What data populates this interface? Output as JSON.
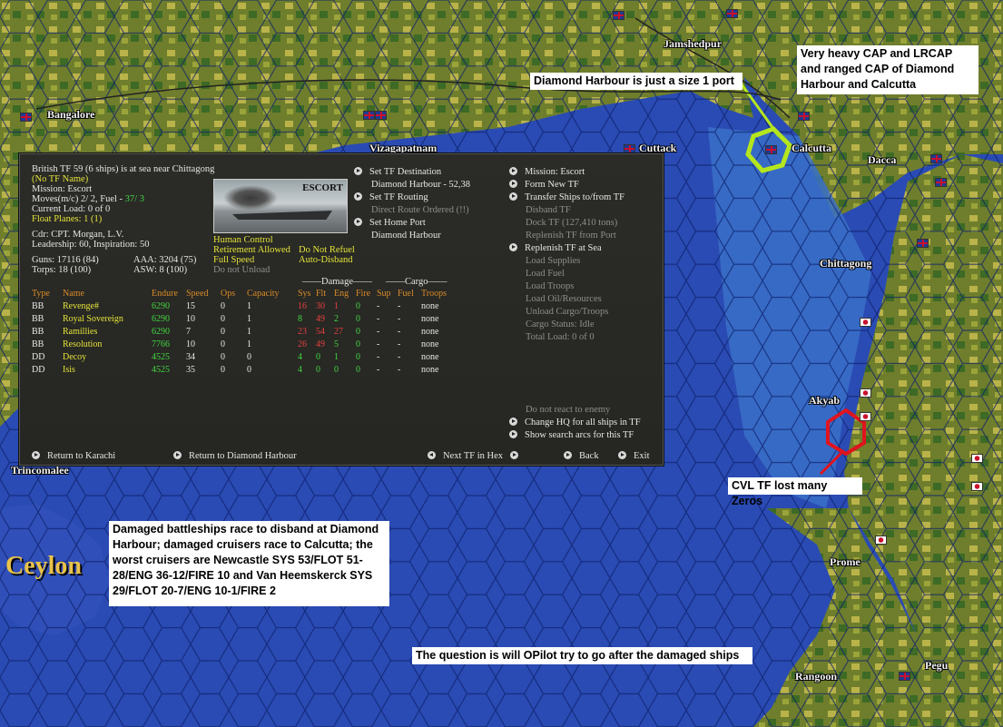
{
  "map_labels": {
    "bangalore": "Bangalore",
    "vizagapatnam": "Vizagapatnam",
    "cuttack": "Cuttack",
    "calcutta": "Calcutta",
    "jamshedpur": "Jamshedpur",
    "dacca": "Dacca",
    "chittagong": "Chittagong",
    "akyab": "Akyab",
    "trincomalee": "Trincomalee",
    "ceylon": "Ceylon",
    "prome": "Prome",
    "rangoon": "Rangoon",
    "pegu": "Pegu"
  },
  "annotations": {
    "cap": "Very heavy CAP and LRCAP and ranged CAP of Diamond Harbour and Calcutta",
    "diamond": "Diamond Harbour is just a size 1 port",
    "cvl": "CVL TF lost many Zeros",
    "damaged": "Damaged battleships race to disband at Diamond Harbour; damaged cruisers race to Calcutta; the worst cruisers are Newcastle SYS 53/FLOT 51-28/ENG 36-12/FIRE 10 and Van Heemskerck SYS 29/FLOT 20-7/ENG 10-1/FIRE 2",
    "question": "The question is will OPilot try to go after the damaged ships"
  },
  "tf": {
    "header": "British TF 59 (6 ships) is at sea near Chittagong",
    "name": "(No TF Name)",
    "mission": "Mission: Escort",
    "moves_a": "Moves(m/c) 2/ 2, Fuel - ",
    "moves_fuel": "37/ 3",
    "current_load": "Current Load: 0 of 0",
    "float_planes": "Float Planes: 1 (1)",
    "cdr": "Cdr: CPT. Morgan, L.V.",
    "leadership": "Leadership: 60, Inspiration: 50",
    "guns": "Guns: 17116 (84)",
    "aaa": "AAA: 3204 (75)",
    "torps": "Torps: 18 (100)",
    "asw": "ASW: 8 (100)",
    "photo_label": "ESCORT",
    "human_control": "Human Control",
    "retirement": "Retirement Allowed",
    "do_not_refuel": "Do Not Refuel",
    "full_speed": "Full Speed",
    "auto_disband": "Auto-Disband",
    "do_not_unload": "Do not Unload"
  },
  "middle_menu": {
    "set_destination": "Set TF Destination",
    "destination_value": "Diamond Harbour - 52,38",
    "set_routing": "Set TF Routing",
    "direct_route": "Direct Route Ordered (!!)",
    "set_home_port": "Set Home Port",
    "home_port_value": "Diamond Harbour"
  },
  "right_menu": {
    "mission": "Mission: Escort",
    "form_new": "Form New TF",
    "transfer": "Transfer Ships to/from TF",
    "disband": "Disband TF",
    "dock": "Dock TF (127,410 tons)",
    "replenish_port": "Replenish TF from Port",
    "replenish_sea": "Replenish TF at Sea",
    "load_supplies": "Load Supplies",
    "load_fuel": "Load Fuel",
    "load_troops": "Load Troops",
    "load_oil": "Load Oil/Resources",
    "unload": "Unload Cargo/Troops",
    "cargo_status": "Cargo Status: Idle",
    "total_load": "Total Load: 0 of 0",
    "do_not_react": "Do not react to enemy",
    "change_hq": "Change HQ for all ships in TF",
    "show_arcs": "Show search arcs for this TF"
  },
  "table": {
    "group_damage": "Damage",
    "group_cargo": "Cargo",
    "headers": [
      "Type",
      "Name",
      "Endure",
      "Speed",
      "Ops",
      "Capacity",
      "Sys",
      "Flt",
      "Eng",
      "Fire",
      "Sup",
      "Fuel",
      "Troops"
    ],
    "rows": [
      [
        "BB",
        "Revenge#",
        "6290",
        "15",
        "0",
        "1",
        "16",
        "30",
        "1",
        "0",
        "-",
        "-",
        "none"
      ],
      [
        "BB",
        "Royal Sovereign",
        "6290",
        "10",
        "0",
        "1",
        "8",
        "49",
        "2",
        "0",
        "-",
        "-",
        "none"
      ],
      [
        "BB",
        "Ramillies",
        "6290",
        "7",
        "0",
        "1",
        "23",
        "54",
        "27",
        "0",
        "-",
        "-",
        "none"
      ],
      [
        "BB",
        "Resolution",
        "7766",
        "10",
        "0",
        "1",
        "26",
        "49",
        "5",
        "0",
        "-",
        "-",
        "none"
      ],
      [
        "DD",
        "Decoy",
        "4525",
        "34",
        "0",
        "0",
        "4",
        "0",
        "1",
        "0",
        "-",
        "-",
        "none"
      ],
      [
        "DD",
        "Isis",
        "4525",
        "35",
        "0",
        "0",
        "4",
        "0",
        "0",
        "0",
        "-",
        "-",
        "none"
      ]
    ]
  },
  "footer": {
    "return_karachi": "Return to Karachi",
    "return_diamond": "Return to Diamond Harbour",
    "next_tf": "Next TF in Hex",
    "back": "Back",
    "exit": "Exit"
  }
}
